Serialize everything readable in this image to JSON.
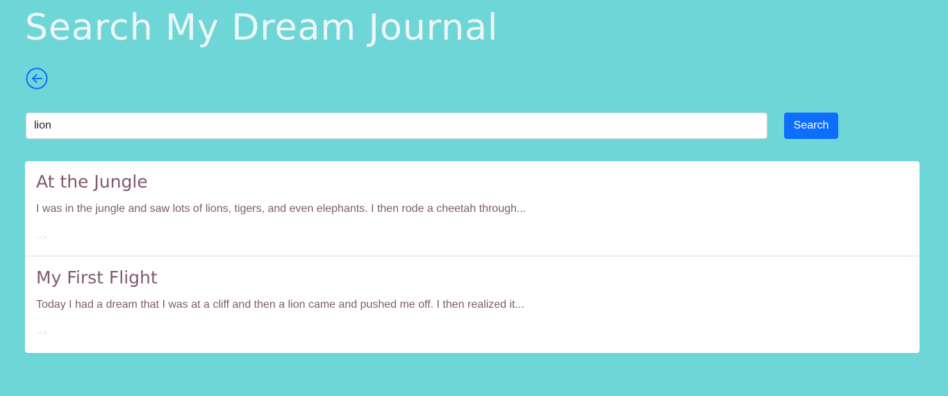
{
  "page": {
    "title": "Search My Dream Journal"
  },
  "back_button": {
    "icon": "arrow-left-circle-icon",
    "color": "#0d6efd"
  },
  "search": {
    "value": "lion",
    "button_label": "Search"
  },
  "results": [
    {
      "title": "At the Jungle",
      "snippet": "I was in the jungle and saw lots of lions, tigers, and even elephants. I then rode a cheetah through...",
      "link_text": "-->"
    },
    {
      "title": "My First Flight",
      "snippet": "Today I had a dream that I was at a cliff and then a lion came and pushed me off. I then realized it...",
      "link_text": "-->"
    }
  ],
  "colors": {
    "background": "#6fd6d8",
    "title_text": "#eef6f6",
    "accent": "#0d6efd",
    "result_text": "#7d5a70"
  }
}
